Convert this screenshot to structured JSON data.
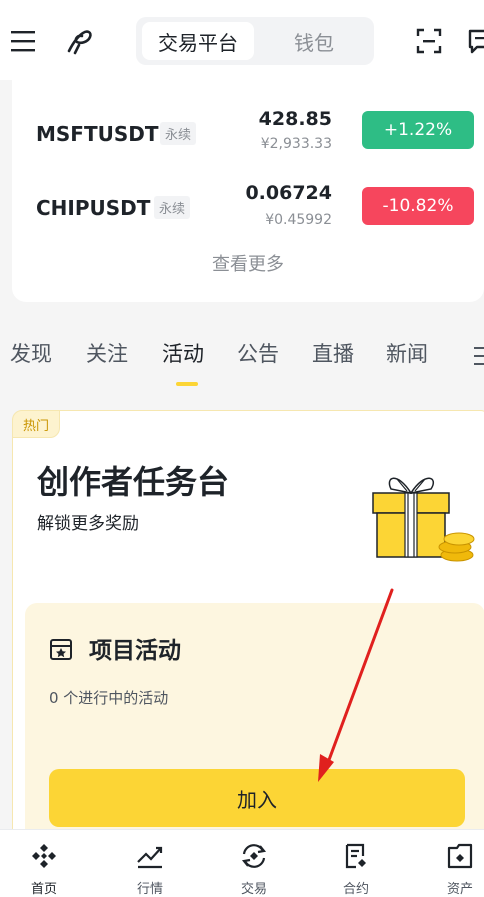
{
  "header": {
    "segment_tabs": [
      "交易平台",
      "钱包"
    ],
    "menu_icon": "menu-icon",
    "brand_icon": "brand-icon",
    "scan_icon": "scan-icon",
    "message_icon": "message-icon"
  },
  "market": {
    "rows": [
      {
        "symbol": "MSFTUSDT",
        "badge": "永续",
        "price": "428.85",
        "cny": "¥2,933.33",
        "change": "+1.22%",
        "direction": "up"
      },
      {
        "symbol": "CHIPUSDT",
        "badge": "永续",
        "price": "0.06724",
        "cny": "¥0.45992",
        "change": "-10.82%",
        "direction": "down"
      }
    ],
    "view_more": "查看更多"
  },
  "tabs": [
    "发现",
    "关注",
    "活动",
    "公告",
    "直播",
    "新闻"
  ],
  "active_tab": "活动",
  "activity": {
    "hot_badge": "热门",
    "title": "创作者任务台",
    "subtitle": "解锁更多奖励",
    "project_title": "项目活动",
    "project_count": "0 个进行中的活动",
    "join_label": "加入"
  },
  "bottom_nav": [
    {
      "label": "首页",
      "icon": "home-icon",
      "active": true
    },
    {
      "label": "行情",
      "icon": "markets-icon",
      "active": false
    },
    {
      "label": "交易",
      "icon": "trade-icon",
      "active": false
    },
    {
      "label": "合约",
      "icon": "futures-icon",
      "active": false
    },
    {
      "label": "资产",
      "icon": "assets-icon",
      "active": false
    }
  ],
  "colors": {
    "accent": "#fcd535",
    "up": "#2ebd85",
    "down": "#f6465d",
    "annotation_arrow": "#e0201e"
  }
}
